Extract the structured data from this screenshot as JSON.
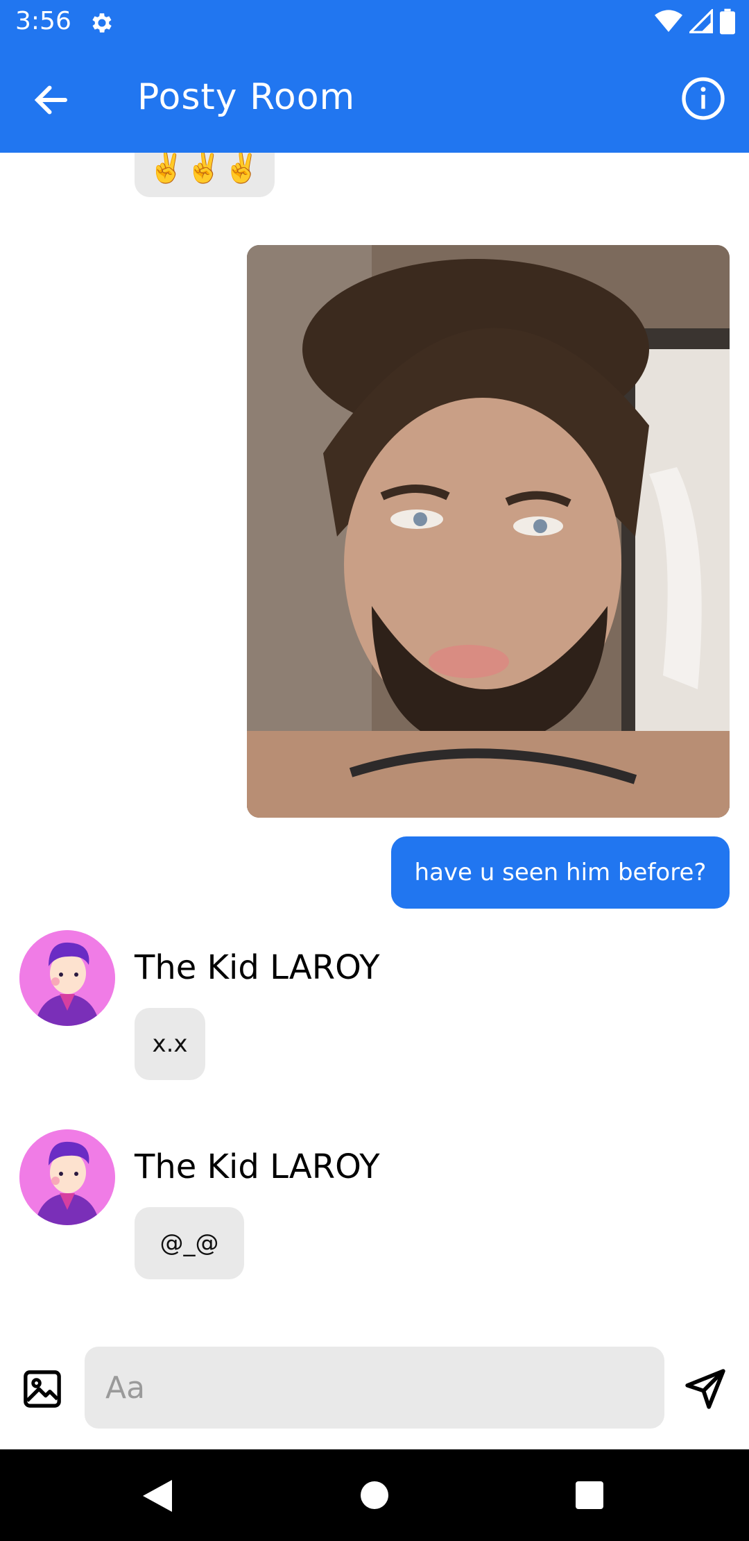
{
  "status_bar": {
    "time": "3:56"
  },
  "app_bar": {
    "title": "Posty Room"
  },
  "messages": [
    {
      "type": "text",
      "direction": "incoming",
      "text": "✌️✌️✌️"
    },
    {
      "type": "image",
      "direction": "outgoing",
      "alt": ""
    },
    {
      "type": "text",
      "direction": "outgoing",
      "text": "have u seen him before?"
    },
    {
      "type": "text",
      "direction": "incoming",
      "sender": "The Kid LAROY",
      "text": "x.x"
    },
    {
      "type": "text",
      "direction": "incoming",
      "sender": "The Kid LAROY",
      "text": "@_@"
    }
  ],
  "composer": {
    "placeholder": "Aa",
    "value": ""
  },
  "colors": {
    "primary": "#2176f0",
    "incoming_bubble": "#e9e9e9",
    "avatar_bg": "#f07ce6"
  }
}
